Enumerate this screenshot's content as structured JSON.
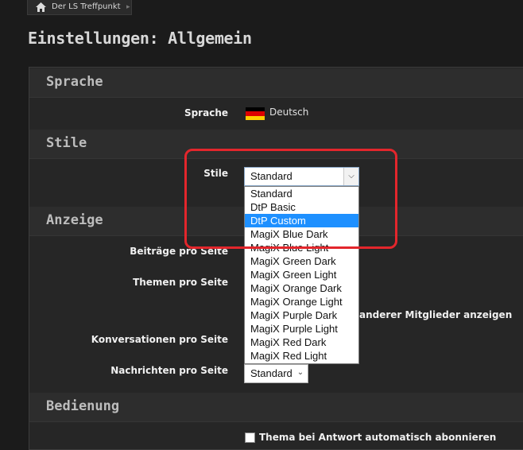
{
  "breadcrumb": {
    "label": "Der LS Treffpunkt"
  },
  "page_title": "Einstellungen: Allgemein",
  "sections": {
    "sprache": "Sprache",
    "stile": "Stile",
    "anzeige": "Anzeige",
    "bedienung": "Bedienung"
  },
  "language": {
    "label": "Sprache",
    "value": "Deutsch"
  },
  "style": {
    "label": "Stile",
    "selected": "Standard",
    "options": [
      "Standard",
      "DtP Basic",
      "DtP Custom",
      "MagiX Blue Dark",
      "MagiX Blue Light",
      "MagiX Green Dark",
      "MagiX Green Light",
      "MagiX Orange Dark",
      "MagiX Orange Light",
      "MagiX Purple Dark",
      "MagiX Purple Light",
      "MagiX Red Dark",
      "MagiX Red Light"
    ],
    "highlighted": "DtP Custom"
  },
  "display": {
    "beitraege_label": "Beiträge pro Seite",
    "themen_label": "Themen pro Seite",
    "partial_checkbox_text": "anderer Mitglieder anzeigen",
    "konversationen_label": "Konversationen pro Seite",
    "nachrichten_label": "Nachrichten pro Seite",
    "nachrichten_value": "Standard"
  },
  "usage": {
    "partial_text": "Thema bei Antwort automatisch abonnieren"
  },
  "colors": {
    "highlight_border": "#e3262c",
    "selected_option": "#1e90ff"
  }
}
